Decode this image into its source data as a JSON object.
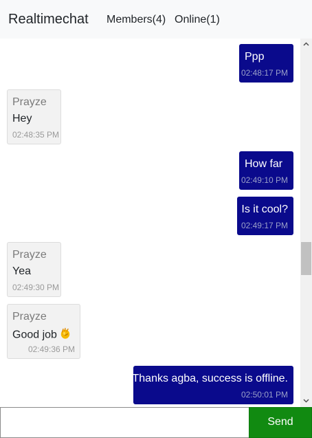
{
  "navbar": {
    "brand": "Realtimechat",
    "members_link": "Members(4)",
    "online_link": "Online(1)"
  },
  "messages": [
    {
      "direction": "out",
      "text": "Ppp",
      "time": "02:48:17 PM"
    },
    {
      "direction": "in",
      "sender": "Prayze",
      "text": "Hey",
      "time": "02:48:35 PM"
    },
    {
      "direction": "out",
      "text": "How far",
      "time": "02:49:10 PM"
    },
    {
      "direction": "out",
      "text": "Is it cool?",
      "time": "02:49:17 PM"
    },
    {
      "direction": "in",
      "sender": "Prayze",
      "text": "Yea",
      "time": "02:49:30 PM"
    },
    {
      "direction": "in",
      "sender": "Prayze",
      "text": "Good job",
      "icon": "clapping-hands-icon",
      "time": "02:49:36 PM"
    },
    {
      "direction": "out",
      "text": "Thanks agba, success is offline.",
      "time": "02:50:01 PM"
    }
  ],
  "compose": {
    "input_value": "",
    "input_placeholder": "",
    "send_label": "Send"
  },
  "colors": {
    "outgoing_bubble": "#0a0a8c",
    "incoming_bubble": "#f2f2f2",
    "send_button": "#118a11",
    "navbar_bg": "#f8f9fa"
  }
}
